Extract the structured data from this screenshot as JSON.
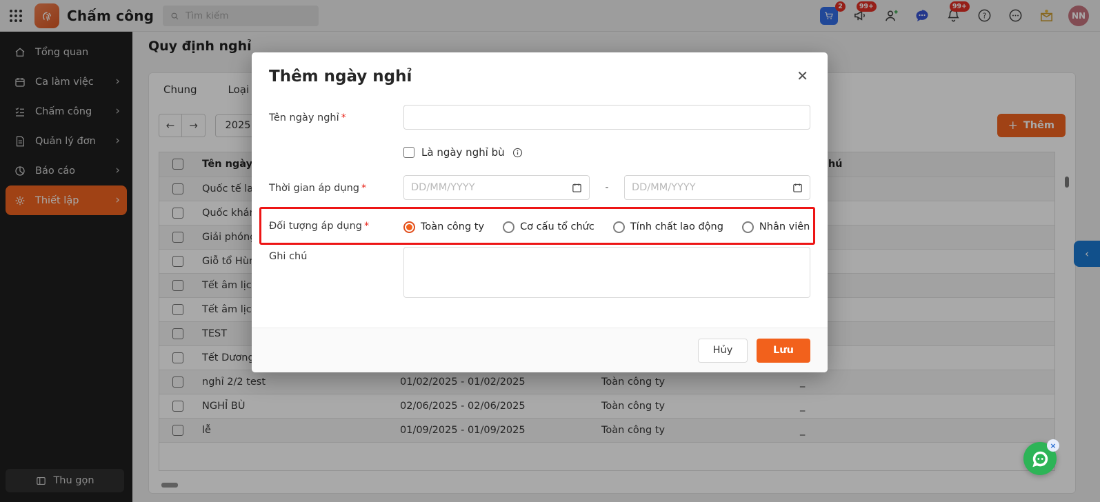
{
  "topbar": {
    "app_title": "Chấm công",
    "search_placeholder": "Tìm kiếm",
    "badges": {
      "cart": "2",
      "announce": "99+",
      "notifications": "99+"
    },
    "avatar_initials": "NN"
  },
  "sidebar": {
    "items": [
      {
        "key": "overview",
        "label": "Tổng quan",
        "icon": "home-icon",
        "chevron": false,
        "active": false
      },
      {
        "key": "shifts",
        "label": "Ca làm việc",
        "icon": "calendar-icon",
        "chevron": true,
        "active": false
      },
      {
        "key": "timekeeping",
        "label": "Chấm công",
        "icon": "checklist-icon",
        "chevron": true,
        "active": false
      },
      {
        "key": "requests",
        "label": "Quản lý đơn",
        "icon": "document-icon",
        "chevron": true,
        "active": false
      },
      {
        "key": "reports",
        "label": "Báo cáo",
        "icon": "pie-chart-icon",
        "chevron": true,
        "active": false
      },
      {
        "key": "settings",
        "label": "Thiết lập",
        "icon": "gear-icon",
        "chevron": true,
        "active": true
      }
    ],
    "collapse_label": "Thu gọn"
  },
  "page": {
    "title": "Quy định nghỉ",
    "tabs": [
      {
        "key": "general",
        "label": "Chung"
      },
      {
        "key": "leave-types",
        "label": "Loại nghỉ"
      }
    ],
    "year": "2025",
    "add_button_label": "Thêm"
  },
  "table": {
    "headers": {
      "name": "Tên ngày nghỉ",
      "period": "",
      "scope": "",
      "note": "Ghi chú"
    },
    "rows": [
      {
        "name": "Quốc tế lao động",
        "period": "",
        "scope": "",
        "note": ""
      },
      {
        "name": "Quốc khánh",
        "period": "",
        "scope": "",
        "note": ""
      },
      {
        "name": "Giải phóng miền Nam",
        "period": "",
        "scope": "",
        "note": ""
      },
      {
        "name": "Giỗ tổ Hùng Vương",
        "period": "",
        "scope": "",
        "note": ""
      },
      {
        "name": "Tết âm lịch",
        "period": "",
        "scope": "",
        "note": ""
      },
      {
        "name": "Tết âm lịch",
        "period": "",
        "scope": "",
        "note": ""
      },
      {
        "name": "TEST",
        "period": "",
        "scope": "",
        "note": ""
      },
      {
        "name": "Tết Dương Lịch",
        "period": "",
        "scope": "",
        "note": ""
      },
      {
        "name": "nghỉ 2/2 test",
        "period": "01/02/2025 - 01/02/2025",
        "scope": "Toàn công ty",
        "note": "_"
      },
      {
        "name": "NGHỈ BÙ",
        "period": "02/06/2025 - 02/06/2025",
        "scope": "Toàn công ty",
        "note": "_"
      },
      {
        "name": "lễ",
        "period": "01/09/2025 - 01/09/2025",
        "scope": "Toàn công ty",
        "note": "_"
      }
    ]
  },
  "modal": {
    "title": "Thêm ngày nghỉ",
    "close_glyph": "✕",
    "fields": {
      "name": {
        "label": "Tên ngày nghỉ",
        "value": ""
      },
      "compensatory": {
        "label": "Là ngày nghỉ bù",
        "checked": false
      },
      "period": {
        "label": "Thời gian áp dụng",
        "placeholder": "DD/MM/YYYY",
        "separator": "-"
      },
      "target": {
        "label": "Đối tượng áp dụng",
        "options": [
          {
            "label": "Toàn công ty",
            "selected": true
          },
          {
            "label": "Cơ cấu tổ chức",
            "selected": false
          },
          {
            "label": "Tính chất lao động",
            "selected": false
          },
          {
            "label": "Nhân viên",
            "selected": false
          }
        ]
      },
      "note": {
        "label": "Ghi chú",
        "value": ""
      }
    },
    "cancel_label": "Hủy",
    "save_label": "Lưu"
  },
  "colors": {
    "accent": "#f2611c",
    "annotation_red": "#ed1515",
    "chat_green": "#2db457"
  }
}
